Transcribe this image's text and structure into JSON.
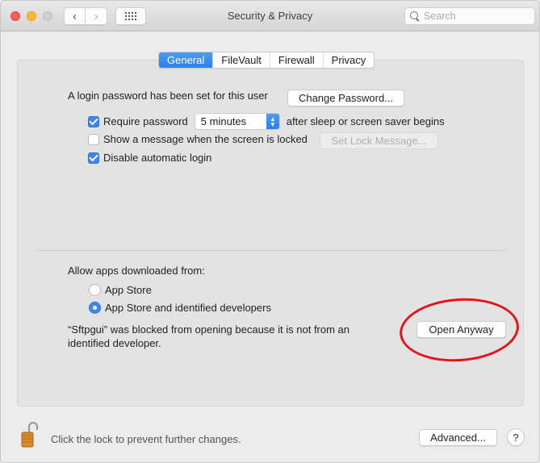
{
  "window": {
    "title": "Security & Privacy",
    "search_placeholder": "Search",
    "search_value": ""
  },
  "titlebar": {
    "buttons": [
      "close",
      "minimize",
      "zoom"
    ],
    "back_glyph": "‹",
    "forward_glyph": "›"
  },
  "tabs": [
    {
      "label": "General",
      "active": true
    },
    {
      "label": "FileVault",
      "active": false
    },
    {
      "label": "Firewall",
      "active": false
    },
    {
      "label": "Privacy",
      "active": false
    }
  ],
  "general": {
    "login_password_text": "A login password has been set for this user",
    "change_password_label": "Change Password...",
    "require_password": {
      "checked": true,
      "label": "Require password",
      "selected": "5 minutes",
      "suffix": "after sleep or screen saver begins"
    },
    "show_message": {
      "checked": false,
      "label": "Show a message when the screen is locked",
      "button_label": "Set Lock Message..."
    },
    "disable_auto_login": {
      "checked": true,
      "label": "Disable automatic login"
    }
  },
  "gatekeeper": {
    "heading": "Allow apps downloaded from:",
    "options": [
      {
        "label": "App Store",
        "selected": false
      },
      {
        "label": "App Store and identified developers",
        "selected": true
      }
    ],
    "blocked_line1": "“Sftpgui” was blocked from opening because it is not from an",
    "blocked_line2": "identified developer.",
    "open_anyway_label": "Open Anyway"
  },
  "footer": {
    "lock_text": "Click the lock to prevent further changes.",
    "advanced_label": "Advanced...",
    "help_label": "?"
  },
  "colors": {
    "accent": "#2a7ff0",
    "annotation": "#e3141c",
    "lock": "#d98a2a"
  }
}
